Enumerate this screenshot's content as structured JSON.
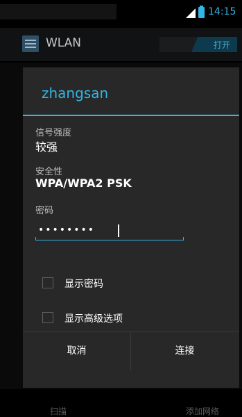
{
  "status_bar": {
    "time": "14:15"
  },
  "action_bar": {
    "title": "WLAN",
    "toggle_label": "打开"
  },
  "dialog": {
    "network_name": "zhangsan",
    "signal_label": "信号强度",
    "signal_value": "较强",
    "security_label": "安全性",
    "security_value": "WPA/WPA2 PSK",
    "password_label": "密码",
    "password_masked": "••••••••",
    "show_password_label": "显示密码",
    "show_advanced_label": "显示高级选项",
    "cancel_label": "取消",
    "connect_label": "连接"
  },
  "bottom_bar": {
    "scan_label": "扫描",
    "add_network_label": "添加网络"
  },
  "colors": {
    "accent": "#33b5e5",
    "dialog_bg": "#282828"
  }
}
